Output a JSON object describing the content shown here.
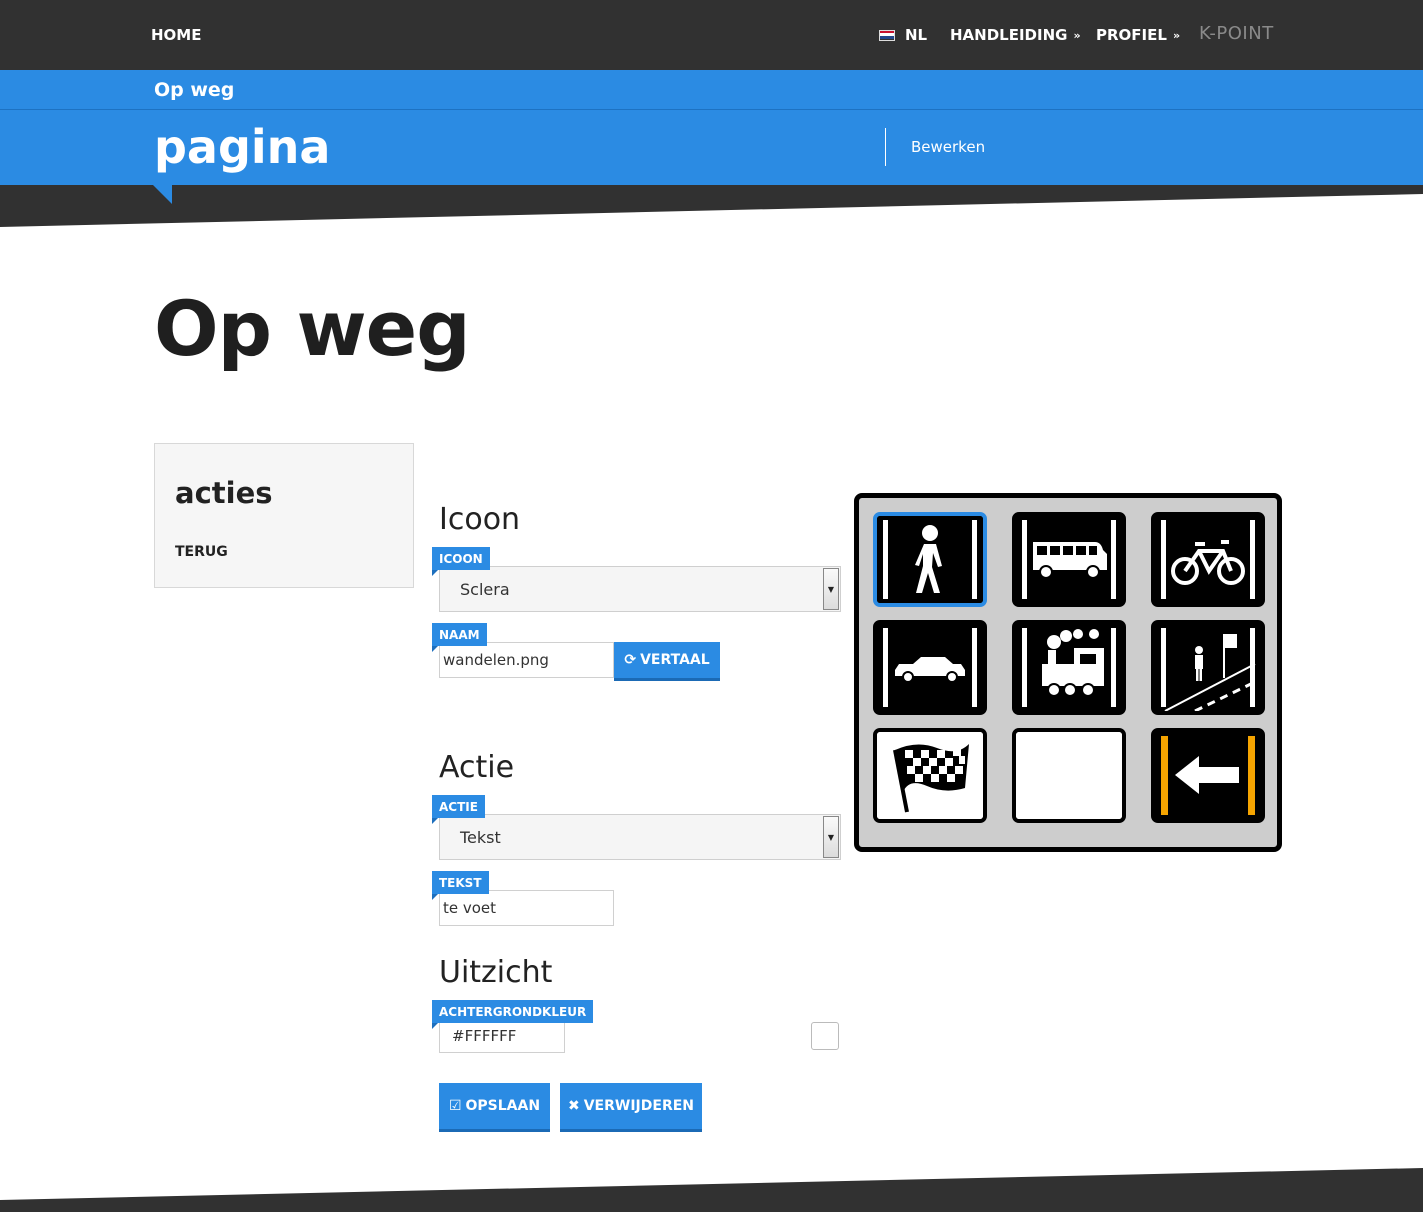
{
  "nav": {
    "home": "HOME",
    "language": "NL",
    "manual": "HANDLEIDING",
    "profile": "PROFIEL",
    "brand": "K-POINT"
  },
  "header": {
    "subtitle": "Op weg",
    "title": "pagina",
    "edit": "Bewerken"
  },
  "page": {
    "heading": "Op weg"
  },
  "sidebar": {
    "title": "acties",
    "back": "TERUG"
  },
  "form": {
    "icon_section": "Icoon",
    "icon_label": "ICOON",
    "icon_value": "Sclera",
    "name_label": "NAAM",
    "name_value": "wandelen.png",
    "translate_button": "VERTAAL",
    "action_section": "Actie",
    "action_label": "ACTIE",
    "action_value": "Tekst",
    "text_label": "TEKST",
    "text_value": "te voet",
    "view_section": "Uitzicht",
    "bg_label": "ACHTERGRONDKLEUR",
    "bg_value": "#FFFFFF",
    "save_button": "OPSLAAN",
    "delete_button": "VERWIJDEREN"
  },
  "board": {
    "tiles": [
      {
        "icon": "walking-person-icon",
        "selected": true
      },
      {
        "icon": "bus-icon",
        "selected": false
      },
      {
        "icon": "bicycle-icon",
        "selected": false
      },
      {
        "icon": "car-icon",
        "selected": false
      },
      {
        "icon": "steam-train-icon",
        "selected": false
      },
      {
        "icon": "bus-stop-icon",
        "selected": false
      },
      {
        "icon": "checkered-flag-icon",
        "selected": false
      },
      {
        "icon": "empty-tile",
        "selected": false
      },
      {
        "icon": "back-arrow-icon",
        "selected": false
      }
    ]
  },
  "colors": {
    "nav_bg": "#313131",
    "accent": "#2b8be3",
    "board_bg": "#cdcdcd",
    "arrow_border": "#f5a400"
  }
}
